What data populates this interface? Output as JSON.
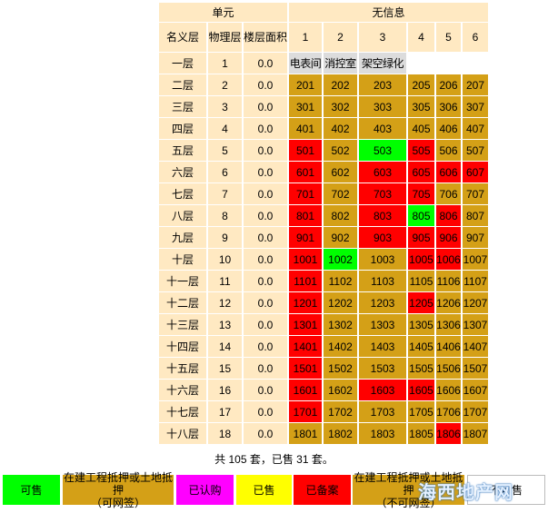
{
  "header": {
    "unit_label": "单元",
    "no_info_label": "无信息",
    "col_nominal": "名义层",
    "col_physical": "物理层",
    "col_area": "楼层面积",
    "room_columns": [
      "1",
      "2",
      "3",
      "4",
      "5",
      "6"
    ]
  },
  "colors": {
    "sold_red": "#ff0000",
    "available_green": "#00ff00",
    "mortgage_tan": "#d4a017",
    "header_bg": "#ffe9c2",
    "subscribed_magenta": "#ff00ff",
    "yellow": "#ffff00",
    "facility_gray": "#dcdcdc"
  },
  "floors": [
    {
      "nominal": "一层",
      "physical": "1",
      "area": "0.0",
      "facilities": [
        "电表间",
        "消控室",
        "架空绿化"
      ]
    },
    {
      "nominal": "二层",
      "physical": "2",
      "area": "0.0",
      "rooms": [
        {
          "no": "201",
          "status": "tan"
        },
        {
          "no": "202",
          "status": "tan"
        },
        {
          "no": "203",
          "status": "tan"
        },
        {
          "no": "205",
          "status": "tan"
        },
        {
          "no": "206",
          "status": "tan"
        },
        {
          "no": "207",
          "status": "tan"
        }
      ]
    },
    {
      "nominal": "三层",
      "physical": "3",
      "area": "0.0",
      "rooms": [
        {
          "no": "301",
          "status": "tan"
        },
        {
          "no": "302",
          "status": "tan"
        },
        {
          "no": "303",
          "status": "tan"
        },
        {
          "no": "305",
          "status": "tan"
        },
        {
          "no": "306",
          "status": "tan"
        },
        {
          "no": "307",
          "status": "tan"
        }
      ]
    },
    {
      "nominal": "四层",
      "physical": "4",
      "area": "0.0",
      "rooms": [
        {
          "no": "401",
          "status": "tan"
        },
        {
          "no": "402",
          "status": "tan"
        },
        {
          "no": "403",
          "status": "tan"
        },
        {
          "no": "405",
          "status": "tan"
        },
        {
          "no": "406",
          "status": "tan"
        },
        {
          "no": "407",
          "status": "tan"
        }
      ]
    },
    {
      "nominal": "五层",
      "physical": "5",
      "area": "0.0",
      "rooms": [
        {
          "no": "501",
          "status": "red"
        },
        {
          "no": "502",
          "status": "tan"
        },
        {
          "no": "503",
          "status": "green"
        },
        {
          "no": "505",
          "status": "red"
        },
        {
          "no": "506",
          "status": "tan"
        },
        {
          "no": "507",
          "status": "tan"
        }
      ]
    },
    {
      "nominal": "六层",
      "physical": "6",
      "area": "0.0",
      "rooms": [
        {
          "no": "601",
          "status": "red"
        },
        {
          "no": "602",
          "status": "tan"
        },
        {
          "no": "603",
          "status": "red"
        },
        {
          "no": "605",
          "status": "red"
        },
        {
          "no": "606",
          "status": "red"
        },
        {
          "no": "607",
          "status": "red"
        }
      ]
    },
    {
      "nominal": "七层",
      "physical": "7",
      "area": "0.0",
      "rooms": [
        {
          "no": "701",
          "status": "red"
        },
        {
          "no": "702",
          "status": "tan"
        },
        {
          "no": "703",
          "status": "red"
        },
        {
          "no": "705",
          "status": "red"
        },
        {
          "no": "706",
          "status": "tan"
        },
        {
          "no": "707",
          "status": "tan"
        }
      ]
    },
    {
      "nominal": "八层",
      "physical": "8",
      "area": "0.0",
      "rooms": [
        {
          "no": "801",
          "status": "red"
        },
        {
          "no": "802",
          "status": "tan"
        },
        {
          "no": "803",
          "status": "red"
        },
        {
          "no": "805",
          "status": "green"
        },
        {
          "no": "806",
          "status": "red"
        },
        {
          "no": "807",
          "status": "tan"
        }
      ]
    },
    {
      "nominal": "九层",
      "physical": "9",
      "area": "0.0",
      "rooms": [
        {
          "no": "901",
          "status": "red"
        },
        {
          "no": "902",
          "status": "tan"
        },
        {
          "no": "903",
          "status": "red"
        },
        {
          "no": "905",
          "status": "red"
        },
        {
          "no": "906",
          "status": "red"
        },
        {
          "no": "907",
          "status": "tan"
        }
      ]
    },
    {
      "nominal": "十层",
      "physical": "10",
      "area": "0.0",
      "rooms": [
        {
          "no": "1001",
          "status": "red"
        },
        {
          "no": "1002",
          "status": "green"
        },
        {
          "no": "1003",
          "status": "tan"
        },
        {
          "no": "1005",
          "status": "red"
        },
        {
          "no": "1006",
          "status": "red"
        },
        {
          "no": "1007",
          "status": "tan"
        }
      ]
    },
    {
      "nominal": "十一层",
      "physical": "11",
      "area": "0.0",
      "rooms": [
        {
          "no": "1101",
          "status": "red"
        },
        {
          "no": "1102",
          "status": "tan"
        },
        {
          "no": "1103",
          "status": "tan"
        },
        {
          "no": "1105",
          "status": "tan"
        },
        {
          "no": "1106",
          "status": "tan"
        },
        {
          "no": "1107",
          "status": "tan"
        }
      ]
    },
    {
      "nominal": "十二层",
      "physical": "12",
      "area": "0.0",
      "rooms": [
        {
          "no": "1201",
          "status": "red"
        },
        {
          "no": "1202",
          "status": "tan"
        },
        {
          "no": "1203",
          "status": "tan"
        },
        {
          "no": "1205",
          "status": "red"
        },
        {
          "no": "1206",
          "status": "tan"
        },
        {
          "no": "1207",
          "status": "tan"
        }
      ]
    },
    {
      "nominal": "十三层",
      "physical": "13",
      "area": "0.0",
      "rooms": [
        {
          "no": "1301",
          "status": "red"
        },
        {
          "no": "1302",
          "status": "tan"
        },
        {
          "no": "1303",
          "status": "tan"
        },
        {
          "no": "1305",
          "status": "tan"
        },
        {
          "no": "1306",
          "status": "tan"
        },
        {
          "no": "1307",
          "status": "tan"
        }
      ]
    },
    {
      "nominal": "十四层",
      "physical": "14",
      "area": "0.0",
      "rooms": [
        {
          "no": "1401",
          "status": "red"
        },
        {
          "no": "1402",
          "status": "tan"
        },
        {
          "no": "1403",
          "status": "tan"
        },
        {
          "no": "1405",
          "status": "tan"
        },
        {
          "no": "1406",
          "status": "tan"
        },
        {
          "no": "1407",
          "status": "tan"
        }
      ]
    },
    {
      "nominal": "十五层",
      "physical": "15",
      "area": "0.0",
      "rooms": [
        {
          "no": "1501",
          "status": "red"
        },
        {
          "no": "1502",
          "status": "tan"
        },
        {
          "no": "1503",
          "status": "tan"
        },
        {
          "no": "1505",
          "status": "tan"
        },
        {
          "no": "1506",
          "status": "tan"
        },
        {
          "no": "1507",
          "status": "tan"
        }
      ]
    },
    {
      "nominal": "十六层",
      "physical": "16",
      "area": "0.0",
      "rooms": [
        {
          "no": "1601",
          "status": "red"
        },
        {
          "no": "1602",
          "status": "tan"
        },
        {
          "no": "1603",
          "status": "red"
        },
        {
          "no": "1605",
          "status": "red"
        },
        {
          "no": "1606",
          "status": "tan"
        },
        {
          "no": "1607",
          "status": "tan"
        }
      ]
    },
    {
      "nominal": "十七层",
      "physical": "17",
      "area": "0.0",
      "rooms": [
        {
          "no": "1701",
          "status": "red"
        },
        {
          "no": "1702",
          "status": "tan"
        },
        {
          "no": "1703",
          "status": "tan"
        },
        {
          "no": "1705",
          "status": "tan"
        },
        {
          "no": "1706",
          "status": "tan"
        },
        {
          "no": "1707",
          "status": "tan"
        }
      ]
    },
    {
      "nominal": "十八层",
      "physical": "18",
      "area": "0.0",
      "rooms": [
        {
          "no": "1801",
          "status": "tan"
        },
        {
          "no": "1802",
          "status": "tan"
        },
        {
          "no": "1803",
          "status": "tan"
        },
        {
          "no": "1805",
          "status": "tan"
        },
        {
          "no": "1806",
          "status": "red"
        },
        {
          "no": "1807",
          "status": "tan"
        }
      ]
    }
  ],
  "summary": "共 105 套，已售 31 套。",
  "legend": [
    {
      "key": "available",
      "lines": [
        "可售"
      ],
      "color": "#00ff00",
      "text_color": "#000000"
    },
    {
      "key": "mortgage",
      "lines": [
        "在建工程抵押或土地抵押",
        "（可网签）"
      ],
      "color": "#d4a017",
      "text_color": "#000000"
    },
    {
      "key": "subscribed",
      "lines": [
        "已认购"
      ],
      "color": "#ff00ff",
      "text_color": "#000000"
    },
    {
      "key": "sold",
      "lines": [
        "已售"
      ],
      "color": "#ffff00",
      "text_color": "#000000"
    },
    {
      "key": "filed",
      "lines": [
        "已备案"
      ],
      "color": "#ff0000",
      "text_color": "#000000"
    },
    {
      "key": "mortgage-nonsign",
      "lines": [
        "在建工程抵押或土地抵押",
        "（不可网签）"
      ],
      "color": "#d4a017",
      "text_color": "#000000"
    },
    {
      "key": "not-for-sale",
      "lines": [
        "不可售"
      ],
      "color": "#ffffff",
      "text_color": "#000000"
    }
  ],
  "watermark": {
    "text": "海西地产网",
    "sub": "www"
  }
}
